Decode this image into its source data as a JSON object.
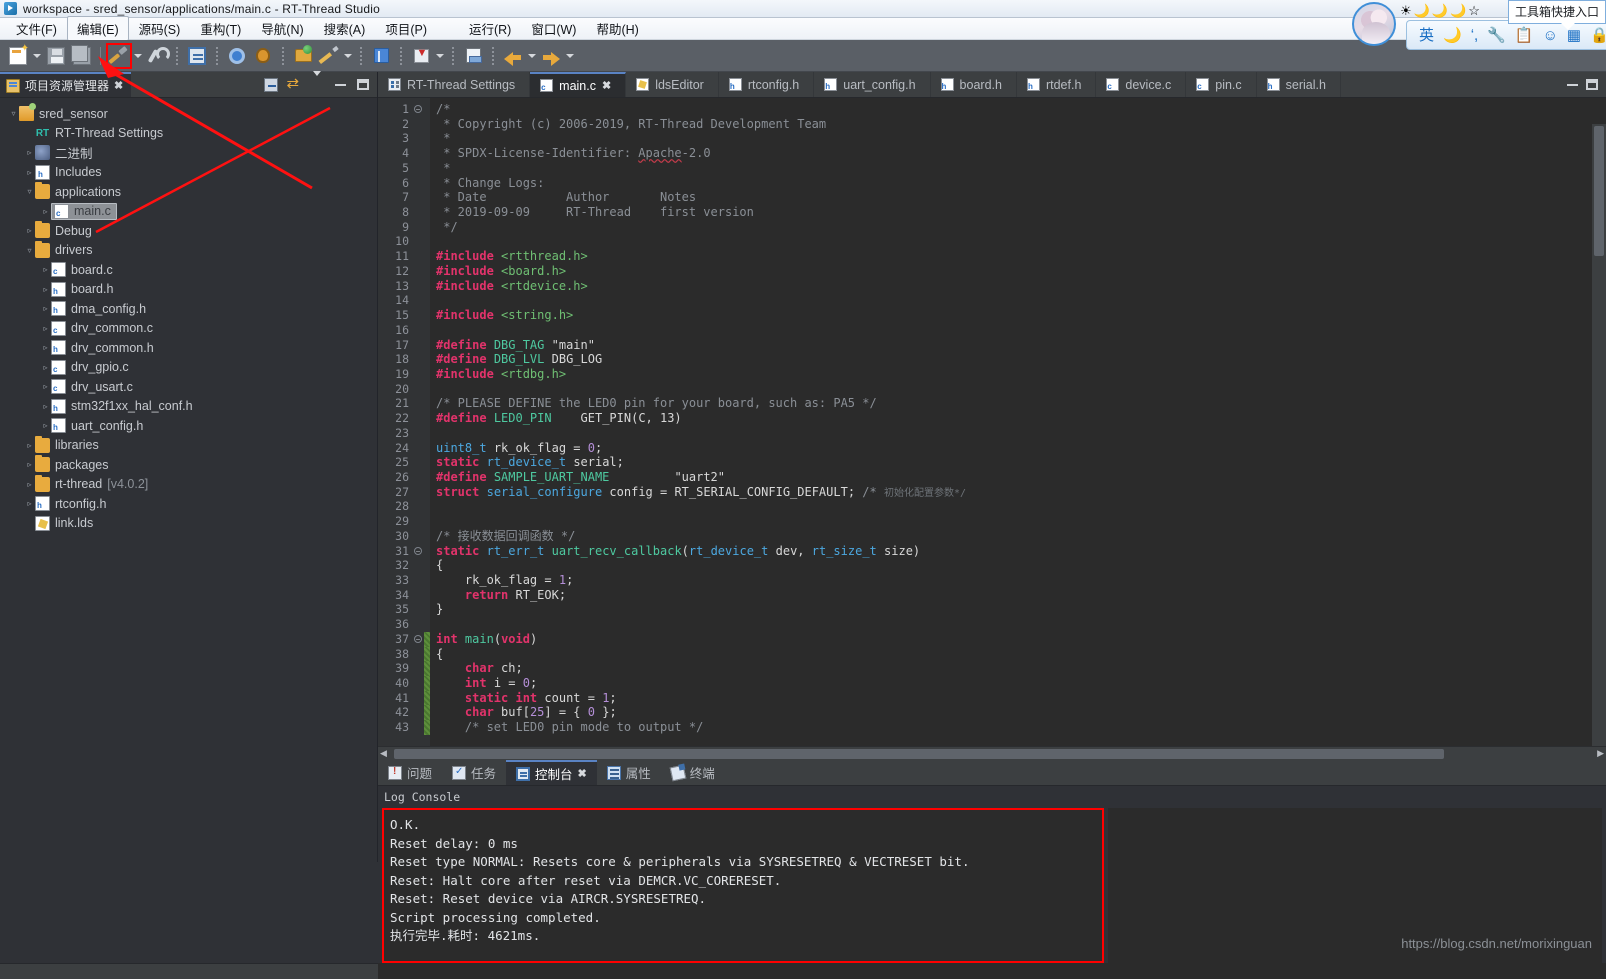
{
  "window": {
    "title": "workspace - sred_sensor/applications/main.c - RT-Thread Studio",
    "logo_icon": "rt-thread-logo-icon"
  },
  "menubar": {
    "items": [
      {
        "label": "文件(F)",
        "name": "menu-file",
        "selected": false
      },
      {
        "label": "编辑(E)",
        "name": "menu-edit",
        "selected": true
      },
      {
        "label": "源码(S)",
        "name": "menu-source",
        "selected": false
      },
      {
        "label": "重构(T)",
        "name": "menu-refactor",
        "selected": false
      },
      {
        "label": "导航(N)",
        "name": "menu-navigate",
        "selected": false
      },
      {
        "label": "搜索(A)",
        "name": "menu-search",
        "selected": false
      },
      {
        "label": "项目(P)",
        "name": "menu-project",
        "selected": false
      },
      {
        "label": "运行(R)",
        "name": "menu-run",
        "selected": false
      },
      {
        "label": "窗口(W)",
        "name": "menu-window",
        "selected": false
      },
      {
        "label": "帮助(H)",
        "name": "menu-help",
        "selected": false
      }
    ]
  },
  "toolbar": {
    "buttons": [
      {
        "icon": "new-file-icon",
        "name": "new-button"
      },
      {
        "icon": "save-icon",
        "name": "save-button"
      },
      {
        "icon": "save-all-icon",
        "name": "save-all-button"
      },
      {
        "icon": "hammer-build-icon",
        "name": "build-button",
        "highlighted": true
      },
      {
        "icon": "wrench-icon",
        "name": "build-configure-button"
      },
      {
        "icon": "console-icon",
        "name": "open-console-button"
      },
      {
        "icon": "gear-run-icon",
        "name": "run-button"
      },
      {
        "icon": "bug-debug-icon",
        "name": "debug-button"
      },
      {
        "icon": "open-folder-icon",
        "name": "open-resource-button"
      },
      {
        "icon": "pencil-edit-icon",
        "name": "edit-button"
      },
      {
        "icon": "book-icon",
        "name": "documentation-button"
      },
      {
        "icon": "import-icon",
        "name": "import-button"
      },
      {
        "icon": "drawer-icon",
        "name": "package-manager-button"
      },
      {
        "icon": "arrow-left-icon",
        "name": "back-button"
      },
      {
        "icon": "arrow-right-icon",
        "name": "forward-button"
      }
    ]
  },
  "ime": {
    "tooltip": "工具箱快捷入口",
    "lang_label": "英",
    "icons": [
      "moon-icon",
      "voice-input-icon",
      "wrench-icon",
      "clipboard-icon",
      "smiley-icon",
      "toolbox-icon",
      "lock-icon"
    ],
    "stars": [
      "☀",
      "🌙",
      "🌙",
      "🌙",
      "☆"
    ],
    "avatar": "user-avatar"
  },
  "project_explorer": {
    "tab_label": "项目资源管理器",
    "tab_close": "✖",
    "tools": [
      "collapse-all-icon",
      "link-with-editor-icon",
      "view-menu-icon",
      "minimize-icon",
      "maximize-icon"
    ],
    "tree": [
      {
        "label": "sred_sensor",
        "icon": "project-folder-icon",
        "indent": 0,
        "twisty": "▿",
        "kind": "project"
      },
      {
        "label": "RT-Thread Settings",
        "icon": "rt-settings-icon",
        "indent": 1,
        "twisty": "",
        "kind": "rt"
      },
      {
        "label": "二进制",
        "icon": "binaries-icon",
        "indent": 1,
        "twisty": "▹",
        "kind": "bin"
      },
      {
        "label": "Includes",
        "icon": "includes-icon",
        "indent": 1,
        "twisty": "▹",
        "kind": "inc"
      },
      {
        "label": "applications",
        "icon": "folder-open-icon",
        "indent": 1,
        "twisty": "▿",
        "kind": "folder"
      },
      {
        "label": "main.c",
        "icon": "c-file-icon",
        "indent": 2,
        "twisty": "▹",
        "kind": "c",
        "selected": true
      },
      {
        "label": "Debug",
        "icon": "folder-icon",
        "indent": 1,
        "twisty": "▹",
        "kind": "folder"
      },
      {
        "label": "drivers",
        "icon": "folder-open-icon",
        "indent": 1,
        "twisty": "▿",
        "kind": "folder"
      },
      {
        "label": "board.c",
        "icon": "c-file-icon",
        "indent": 2,
        "twisty": "▹",
        "kind": "c"
      },
      {
        "label": "board.h",
        "icon": "h-file-icon",
        "indent": 2,
        "twisty": "▹",
        "kind": "h"
      },
      {
        "label": "dma_config.h",
        "icon": "h-file-icon",
        "indent": 2,
        "twisty": "▹",
        "kind": "h"
      },
      {
        "label": "drv_common.c",
        "icon": "c-file-icon",
        "indent": 2,
        "twisty": "▹",
        "kind": "c"
      },
      {
        "label": "drv_common.h",
        "icon": "h-file-icon",
        "indent": 2,
        "twisty": "▹",
        "kind": "h"
      },
      {
        "label": "drv_gpio.c",
        "icon": "c-file-icon",
        "indent": 2,
        "twisty": "▹",
        "kind": "c"
      },
      {
        "label": "drv_usart.c",
        "icon": "c-file-icon",
        "indent": 2,
        "twisty": "▹",
        "kind": "c"
      },
      {
        "label": "stm32f1xx_hal_conf.h",
        "icon": "h-file-icon",
        "indent": 2,
        "twisty": "▹",
        "kind": "h"
      },
      {
        "label": "uart_config.h",
        "icon": "h-file-icon",
        "indent": 2,
        "twisty": "▹",
        "kind": "h"
      },
      {
        "label": "libraries",
        "icon": "folder-icon",
        "indent": 1,
        "twisty": "▹",
        "kind": "folder"
      },
      {
        "label": "packages",
        "icon": "folder-icon",
        "indent": 1,
        "twisty": "▹",
        "kind": "folder"
      },
      {
        "label": "rt-thread",
        "suffix": "[v4.0.2]",
        "icon": "folder-icon",
        "indent": 1,
        "twisty": "▹",
        "kind": "folder"
      },
      {
        "label": "rtconfig.h",
        "icon": "h-file-icon",
        "indent": 1,
        "twisty": "▹",
        "kind": "h"
      },
      {
        "label": "link.lds",
        "icon": "lds-file-icon",
        "indent": 1,
        "twisty": "",
        "kind": "lds"
      }
    ]
  },
  "editor": {
    "tabs": [
      {
        "label": "RT-Thread Settings",
        "icon": "settings-icon",
        "active": false
      },
      {
        "label": "main.c",
        "icon": "c-file-icon",
        "active": true,
        "close": "✖"
      },
      {
        "label": "ldsEditor",
        "icon": "lds-file-icon",
        "active": false
      },
      {
        "label": "rtconfig.h",
        "icon": "h-file-icon",
        "active": false
      },
      {
        "label": "uart_config.h",
        "icon": "h-file-icon",
        "active": false
      },
      {
        "label": "board.h",
        "icon": "h-file-icon",
        "active": false
      },
      {
        "label": "rtdef.h",
        "icon": "h-file-icon",
        "active": false
      },
      {
        "label": "device.c",
        "icon": "c-file-icon",
        "active": false
      },
      {
        "label": "pin.c",
        "icon": "c-file-icon",
        "active": false
      },
      {
        "label": "serial.h",
        "icon": "h-file-icon",
        "active": false
      }
    ],
    "first_line": 1,
    "last_line": 43,
    "code_lines": [
      {
        "n": 1,
        "html": "<span class=\"c-com\">/*</span>",
        "fold": "minus"
      },
      {
        "n": 2,
        "html": "<span class=\"c-com\"> * Copyright (c) 2006-2019, RT-Thread Development Team</span>"
      },
      {
        "n": 3,
        "html": "<span class=\"c-com\"> *</span>"
      },
      {
        "n": 4,
        "html": "<span class=\"c-com\"> * SPDX-License-Identifier: <span class=\"sq\">Apache</span>-2.0</span>"
      },
      {
        "n": 5,
        "html": "<span class=\"c-com\"> *</span>"
      },
      {
        "n": 6,
        "html": "<span class=\"c-com\"> * Change Logs:</span>"
      },
      {
        "n": 7,
        "html": "<span class=\"c-com\"> * Date           Author       Notes</span>"
      },
      {
        "n": 8,
        "html": "<span class=\"c-com\"> * 2019-09-09     RT-Thread    first version</span>"
      },
      {
        "n": 9,
        "html": "<span class=\"c-com\"> */</span>"
      },
      {
        "n": 10,
        "html": ""
      },
      {
        "n": 11,
        "html": "<span class=\"c-pre\">#include</span> <span class=\"c-str\">&lt;rtthread.h&gt;</span>"
      },
      {
        "n": 12,
        "html": "<span class=\"c-pre\">#include</span> <span class=\"c-str\">&lt;board.h&gt;</span>"
      },
      {
        "n": 13,
        "html": "<span class=\"c-pre\">#include</span> <span class=\"c-str\">&lt;rtdevice.h&gt;</span>"
      },
      {
        "n": 14,
        "html": ""
      },
      {
        "n": 15,
        "html": "<span class=\"c-pre\">#include</span> <span class=\"c-str\">&lt;string.h&gt;</span>"
      },
      {
        "n": 16,
        "html": ""
      },
      {
        "n": 17,
        "html": "<span class=\"c-pre\">#define</span> <span class=\"c-def\">DBG_TAG</span> <span class=\"c-plain\">\"main\"</span>"
      },
      {
        "n": 18,
        "html": "<span class=\"c-pre\">#define</span> <span class=\"c-def\">DBG_LVL</span> <span class=\"c-plain\">DBG_LOG</span>"
      },
      {
        "n": 19,
        "html": "<span class=\"c-pre\">#include</span> <span class=\"c-str\">&lt;rtdbg.h&gt;</span>"
      },
      {
        "n": 20,
        "html": ""
      },
      {
        "n": 21,
        "html": "<span class=\"c-com\">/* PLEASE DEFINE the LED0 pin for your board, such as: PA5 */</span>"
      },
      {
        "n": 22,
        "html": "<span class=\"c-pre\">#define</span> <span class=\"c-def\">LED0_PIN</span>    <span class=\"c-plain\">GET_PIN(C, 13)</span>"
      },
      {
        "n": 23,
        "html": ""
      },
      {
        "n": 24,
        "html": "<span class=\"c-type\">uint8_t</span> <span class=\"c-plain\">rk_ok_flag = </span><span class=\"c-num\">0</span><span class=\"c-plain\">;</span>"
      },
      {
        "n": 25,
        "html": "<span class=\"c-kw\">static</span> <span class=\"c-type\">rt_device_t</span> <span class=\"c-plain\">serial;</span>"
      },
      {
        "n": 26,
        "html": "<span class=\"c-pre\">#define</span> <span class=\"c-def\">SAMPLE_UART_NAME</span>         <span class=\"c-plain\">\"uart2\"</span>"
      },
      {
        "n": 27,
        "html": "<span class=\"c-kw\">struct</span> <span class=\"c-type\">serial_configure</span> <span class=\"c-plain\">config = RT_SERIAL_CONFIG_DEFAULT;</span> <span class=\"c-com\">/* </span><span class=\"c-cnnote\">初始化配置参数*/</span>"
      },
      {
        "n": 28,
        "html": ""
      },
      {
        "n": 29,
        "html": ""
      },
      {
        "n": 30,
        "html": "<span class=\"c-com\">/* 接收数据回调函数 */</span>"
      },
      {
        "n": 31,
        "html": "<span class=\"c-kw\">static</span> <span class=\"c-type\">rt_err_t</span> <span class=\"c-fn\">uart_recv_callback</span><span class=\"c-plain\">(</span><span class=\"c-type\">rt_device_t</span> <span class=\"c-plain\">dev, </span><span class=\"c-type\">rt_size_t</span> <span class=\"c-plain\">size)</span>",
        "fold": "minus"
      },
      {
        "n": 32,
        "html": "<span class=\"c-plain\">{</span>"
      },
      {
        "n": 33,
        "html": "<span class=\"c-plain\">    rk_ok_flag = </span><span class=\"c-num\">1</span><span class=\"c-plain\">;</span>"
      },
      {
        "n": 34,
        "html": "    <span class=\"c-kw\">return</span> <span class=\"c-plain\">RT_EOK;</span>"
      },
      {
        "n": 35,
        "html": "<span class=\"c-plain\">}</span>"
      },
      {
        "n": 36,
        "html": ""
      },
      {
        "n": 37,
        "html": "<span class=\"c-kw\">int</span> <span class=\"c-fn\">main</span><span class=\"c-plain\">(</span><span class=\"c-kw\">void</span><span class=\"c-plain\">)</span>",
        "fold": "minus",
        "changed": true
      },
      {
        "n": 38,
        "html": "<span class=\"c-plain\">{</span>",
        "changed": true
      },
      {
        "n": 39,
        "html": "    <span class=\"c-kw\">char</span> <span class=\"c-plain\">ch;</span>",
        "changed": true
      },
      {
        "n": 40,
        "html": "    <span class=\"c-kw\">int</span> <span class=\"c-plain\">i = </span><span class=\"c-num\">0</span><span class=\"c-plain\">;</span>",
        "changed": true
      },
      {
        "n": 41,
        "html": "    <span class=\"c-kw\">static int</span> <span class=\"c-plain\">count = </span><span class=\"c-num\">1</span><span class=\"c-plain\">;</span>",
        "changed": true
      },
      {
        "n": 42,
        "html": "    <span class=\"c-kw\">char</span> <span class=\"c-plain\">buf[</span><span class=\"c-num\">25</span><span class=\"c-plain\">] = { </span><span class=\"c-num\">0</span><span class=\"c-plain\"> };</span>",
        "changed": true
      },
      {
        "n": 43,
        "html": "    <span class=\"c-com\">/* set LED0 pin mode to output */</span>",
        "changed": true
      }
    ]
  },
  "console": {
    "tabs": [
      {
        "label": "问题",
        "icon": "problems-icon",
        "active": false
      },
      {
        "label": "任务",
        "icon": "tasks-icon",
        "active": false
      },
      {
        "label": "控制台",
        "icon": "console-icon",
        "active": true,
        "close": "✖"
      },
      {
        "label": "属性",
        "icon": "properties-icon",
        "active": false
      },
      {
        "label": "终端",
        "icon": "terminal-icon",
        "active": false
      }
    ],
    "title": "Log Console",
    "lines": [
      "O.K.",
      "Reset delay: 0 ms",
      "Reset type NORMAL: Resets core & peripherals via SYSRESETREQ & VECTRESET bit.",
      "Reset: Halt core after reset via DEMCR.VC_CORERESET.",
      "Reset: Reset device via AIRCR.SYSRESETREQ.",
      "Script processing completed.",
      "执行完毕.耗时: 4621ms."
    ]
  },
  "watermark": "https://blog.csdn.net/morixinguan",
  "colors": {
    "accent_blue": "#5a83c4",
    "annotation_red": "#ff0000",
    "editor_bg": "#2b2b2b",
    "panel_bg": "#2f3136",
    "chrome_bg": "#3c3f41"
  }
}
